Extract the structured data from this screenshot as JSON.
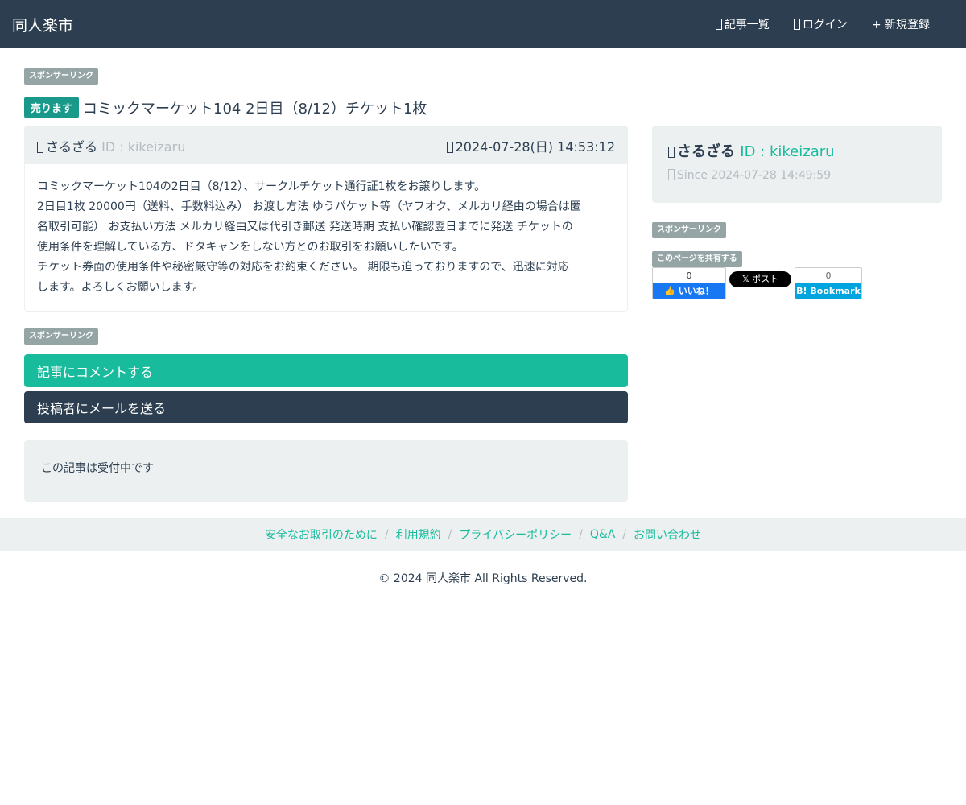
{
  "navbar": {
    "brand": "同人楽市",
    "items": [
      {
        "label": "記事一覧",
        "icon": "list-icon"
      },
      {
        "label": "ログイン",
        "icon": "login-icon"
      },
      {
        "label": "+ 新規登録",
        "icon": ""
      }
    ]
  },
  "sponsor_label": "スポンサーリンク",
  "post": {
    "badge": "売ります",
    "title": "コミックマーケット104 2日目（8/12）チケット1枚",
    "author_name": "さるざる",
    "author_id": "ID : kikeizaru",
    "date": "2024-07-28(日) 14:53:12",
    "body_lines": [
      "コミックマーケット104の2日目（8/12）、サークルチケット通行証1枚をお譲りします。",
      "2日目1枚 20000円（送料、手数料込み） お渡し方法 ゆうパケット等（ヤフオク、メルカリ経由の場合は匿",
      "名取引可能） お支払い方法 メルカリ経由又は代引き郵送 発送時期 支払い確認翌日までに発送 チケットの",
      "使用条件を理解している方、ドタキャンをしない方とのお取引をお願いしたいです。",
      "チケット券面の使用条件や秘密厳守等の対応をお約束ください。 期限も迫っておりますので、迅速に対応",
      "します。よろしくお願いします。"
    ]
  },
  "buttons": {
    "comment": "記事にコメントする",
    "mail": "投稿者にメールを送る"
  },
  "status": "この記事は受付中です",
  "profile": {
    "name": "さるざる",
    "id": "ID : kikeizaru",
    "since": "Since 2024-07-28 14:49:59"
  },
  "share": {
    "label": "このページを共有する",
    "fb_count": "0",
    "fb_label": "いいね！",
    "x_label": "𝕏 ポスト",
    "hb_count": "0",
    "hb_label": "B! Bookmark"
  },
  "footer": {
    "links": [
      "安全なお取引のために",
      "利用規約",
      "プライバシーポリシー",
      "Q&A",
      "お問い合わせ"
    ],
    "copyright": "© 2024 同人楽市 All Rights Reserved."
  },
  "colors": {
    "navbar": "#2c3e50",
    "accent": "#18bc9c",
    "well": "#ecf0f1",
    "badge": "#18998a"
  }
}
